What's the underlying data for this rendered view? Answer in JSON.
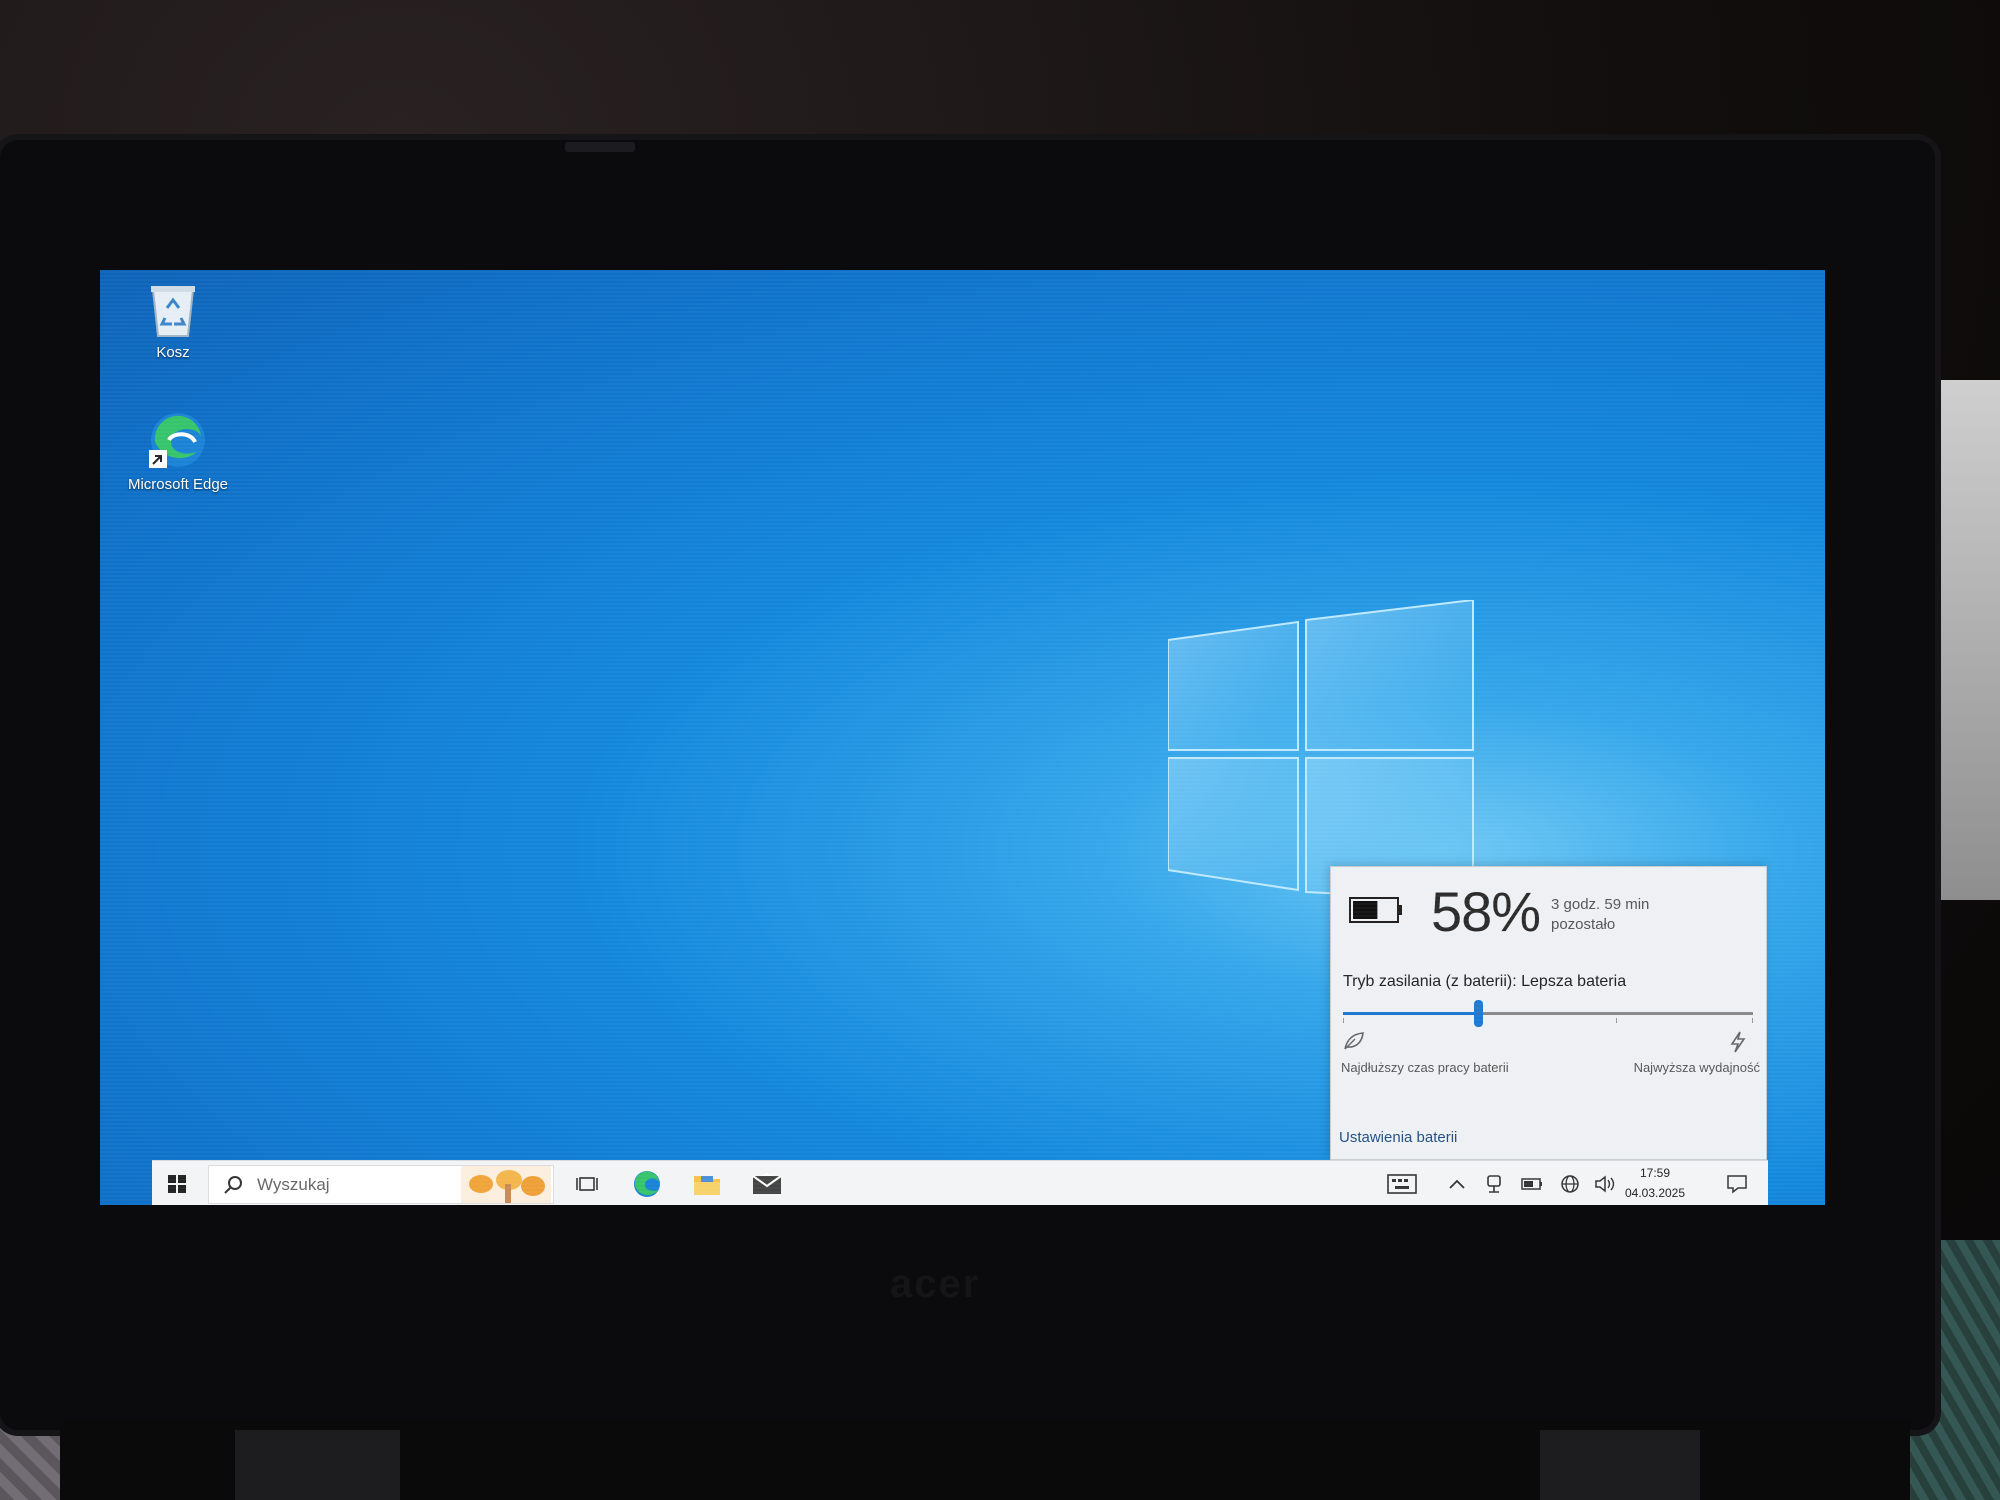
{
  "desktop": {
    "icons": [
      {
        "label": "Kosz",
        "icon": "recycle-bin-icon"
      },
      {
        "label": "Microsoft Edge",
        "icon": "edge-icon"
      }
    ]
  },
  "battery_flyout": {
    "percent": "58%",
    "battery_level": 0.58,
    "remaining_line1": "3 godz. 59 min",
    "remaining_line2": "pozostało",
    "power_mode": "Tryb zasilania (z baterii): Lepsza bateria",
    "slider_position": 0.33,
    "label_left": "Najdłuższy czas pracy baterii",
    "label_right": "Najwyższa wydajność",
    "settings_link": "Ustawienia baterii",
    "accent": "#1f78d1"
  },
  "taskbar": {
    "search_placeholder": "Wyszukaj",
    "pinned": [
      "start-icon",
      "search-highlight-icon",
      "task-view-icon",
      "edge-icon",
      "file-explorer-icon",
      "mail-icon"
    ],
    "tray": [
      "keyboard-icon",
      "chevron-up-icon",
      "meet-now-icon",
      "battery-icon",
      "network-icon",
      "volume-icon",
      "notification-icon"
    ],
    "time": "17:59",
    "date": "04.03.2025"
  }
}
